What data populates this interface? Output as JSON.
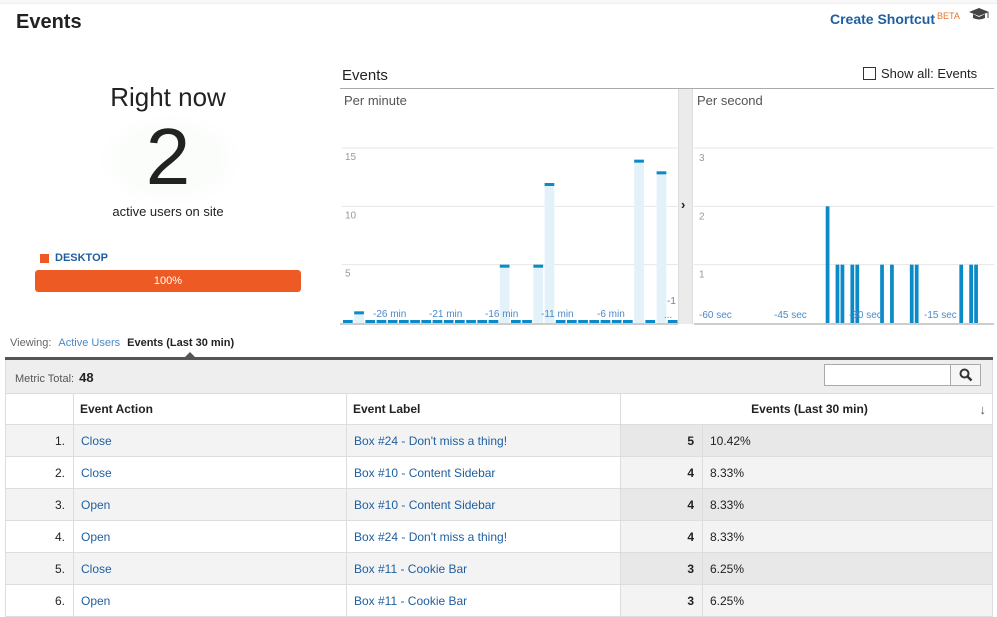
{
  "header": {
    "title": "Events",
    "create_shortcut": "Create Shortcut",
    "beta": "BETA"
  },
  "right_now": {
    "title": "Right now",
    "count": "2",
    "subtitle": "active users on site",
    "device": {
      "label": "DESKTOP",
      "percent_label": "100%",
      "percent": 100,
      "color": "#ee5a24"
    }
  },
  "chart": {
    "title": "Events",
    "show_all_label": "Show all: Events",
    "show_all_checked": false,
    "divider_icon": "chevron-right-icon"
  },
  "chart_data": [
    {
      "type": "bar",
      "title": "Per minute",
      "ylim": [
        0,
        17
      ],
      "yticks": [
        5,
        10,
        15
      ],
      "xtick_labels": [
        "-26 min",
        "-21 min",
        "-16 min",
        "-11 min",
        "-6 min",
        "-1 ..."
      ],
      "x": [
        -30,
        -29,
        -28,
        -27,
        -26,
        -25,
        -24,
        -23,
        -22,
        -21,
        -20,
        -19,
        -18,
        -17,
        -16,
        -15,
        -14,
        -13,
        -12,
        -11,
        -10,
        -9,
        -8,
        -7,
        -6,
        -5,
        -4,
        -3,
        -2,
        -1
      ],
      "values": [
        0,
        1,
        0,
        0,
        0,
        0,
        0,
        0,
        0,
        0,
        0,
        0,
        0,
        0,
        5,
        0,
        0,
        5,
        12,
        0,
        0,
        0,
        0,
        0,
        0,
        0,
        14,
        0,
        13,
        0
      ],
      "color": "#0a8ac7",
      "bg_color": "#e3f1f9"
    },
    {
      "type": "bar",
      "title": "Per second",
      "ylim": [
        0,
        3.5
      ],
      "yticks": [
        1,
        2,
        3
      ],
      "xtick_labels": [
        "-60 sec",
        "-45 sec",
        "-30 sec",
        "-15 sec"
      ],
      "values_by_second": {
        "-34": 2,
        "-32": 1,
        "-31": 1,
        "-29": 1,
        "-28": 1,
        "-23": 1,
        "-21": 1,
        "-17": 1,
        "-16": 1,
        "-7": 1,
        "-5": 1,
        "-4": 1
      },
      "color": "#0a8ac7"
    }
  ],
  "viewing": {
    "label": "Viewing:",
    "active_users": "Active Users",
    "current": "Events (Last 30 min)"
  },
  "metric": {
    "label": "Metric Total:",
    "value": "48",
    "search_placeholder": ""
  },
  "table": {
    "columns": [
      "Event Action",
      "Event Label",
      "Events (Last 30 min)"
    ],
    "rows": [
      {
        "idx": "1.",
        "action": "Close",
        "label": "Box #24 - Don't miss a thing!",
        "value": "5",
        "pct": "10.42%"
      },
      {
        "idx": "2.",
        "action": "Close",
        "label": "Box #10 - Content Sidebar",
        "value": "4",
        "pct": "8.33%"
      },
      {
        "idx": "3.",
        "action": "Open",
        "label": "Box #10 - Content Sidebar",
        "value": "4",
        "pct": "8.33%"
      },
      {
        "idx": "4.",
        "action": "Open",
        "label": "Box #24 - Don't miss a thing!",
        "value": "4",
        "pct": "8.33%"
      },
      {
        "idx": "5.",
        "action": "Close",
        "label": "Box #11 - Cookie Bar",
        "value": "3",
        "pct": "6.25%"
      },
      {
        "idx": "6.",
        "action": "Open",
        "label": "Box #11 - Cookie Bar",
        "value": "3",
        "pct": "6.25%"
      }
    ]
  }
}
